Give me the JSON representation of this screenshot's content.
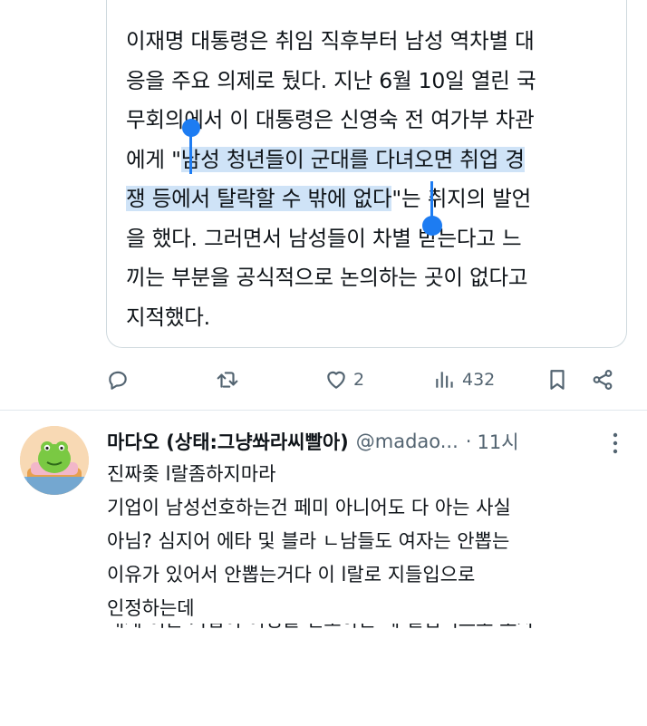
{
  "quote": {
    "lines": [
      "이재명 대통령은 취임 직후부터 남성 역차별 대",
      "응을 주요 의제로 뒀다. 지난 6월 10일 열린 국",
      "무회의에서 이 대통령은 신영숙 전 여가부 차관"
    ],
    "line4_pre": "에게 \"",
    "line4_sel": "남성 청년들이 군대를 다녀오면 취업 경",
    "line5_sel": "쟁 등에서 탈락할 수 밖에 없다",
    "line5_post": "\"는 취지의 발언",
    "lines_after": [
      "을 했다. 그러면서 남성들이 차별 받는다고 느",
      "끼는 부분을 공식적으로 논의하는 곳이 없다고",
      "지적했다."
    ]
  },
  "actions": {
    "reply_icon": "reply-icon",
    "retweet_icon": "retweet-icon",
    "like_icon": "heart-icon",
    "like_count": "2",
    "views_icon": "views-icon",
    "views_count": "432",
    "bookmark_icon": "bookmark-icon",
    "share_icon": "share-icon"
  },
  "reply": {
    "display_name": "마다오 (상태:그냥쏴라씨빨아)",
    "handle": "@madao...",
    "separator": "·",
    "time": "11시",
    "lines": [
      "진짜좆  l랄좀하지마라",
      "기업이 남성선호하는건 페미 아니어도 다 아는 사실",
      "아님? 심지어 에타 및 블라 ㄴ남들도 여자는 안뽑는",
      "이유가 있어서 안뽑는거다 이  l랄로 지들입으로",
      "인정하는데"
    ],
    "cut_line": "대체 이는 기업이 여성을 선호하는 데 실험적으로 보자"
  },
  "colors": {
    "selection": "#cfe3f7",
    "selection_handle": "#1d7cf2",
    "icon_gray": "#536471",
    "text": "#0f1419"
  }
}
